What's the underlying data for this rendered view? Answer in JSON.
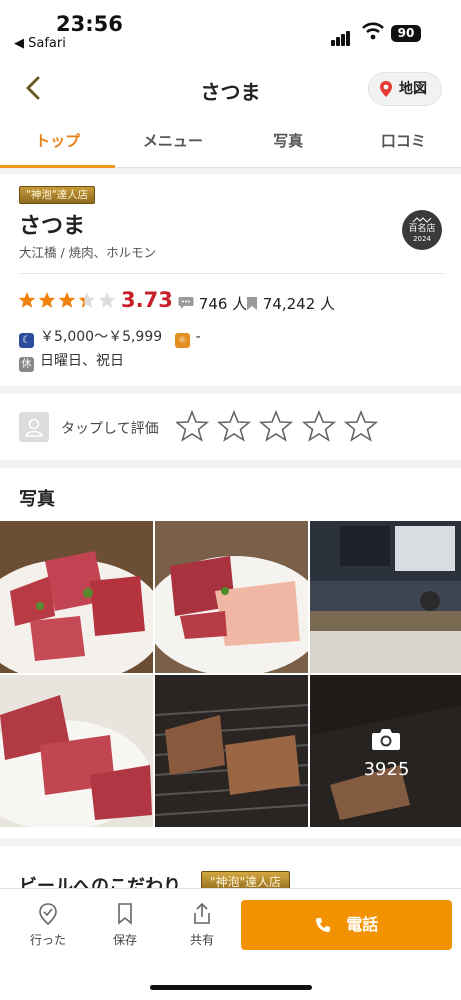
{
  "status_bar": {
    "time": "23:56",
    "back_app": "◀ Safari",
    "battery": "90"
  },
  "nav": {
    "title": "さつま",
    "map_label": "地図"
  },
  "tabs": [
    {
      "label": "トップ",
      "active": true
    },
    {
      "label": "メニュー",
      "active": false
    },
    {
      "label": "写真",
      "active": false
    },
    {
      "label": "口コミ",
      "active": false
    }
  ],
  "restaurant": {
    "badge": "\"神泡\"達人店",
    "name": "さつま",
    "area": "大江橋 / 焼肉、ホルモン",
    "hyakumeiten": {
      "label": "百名店",
      "year": "2024"
    },
    "rating": 3.73,
    "rating_text": "3.73",
    "review_count": "746 人",
    "save_count": "74,242 人",
    "dinner_price": "￥5,000～￥5,999",
    "lunch_price": "-",
    "holidays": "日曜日、祝日",
    "holiday_icon": "休"
  },
  "rate_prompt": {
    "label": "タップして評価",
    "stars": 5
  },
  "photos": {
    "title": "写真",
    "count": "3925"
  },
  "beer": {
    "title": "ビールへのこだわり",
    "badge": "\"神泡\"達人店"
  },
  "bottom_bar": {
    "visited": "行った",
    "save": "保存",
    "share": "共有",
    "call": "電話"
  },
  "colors": {
    "accent": "#f39200",
    "tab_active": "#e8821a",
    "score": "#c7202b",
    "star": "#f0820f"
  }
}
